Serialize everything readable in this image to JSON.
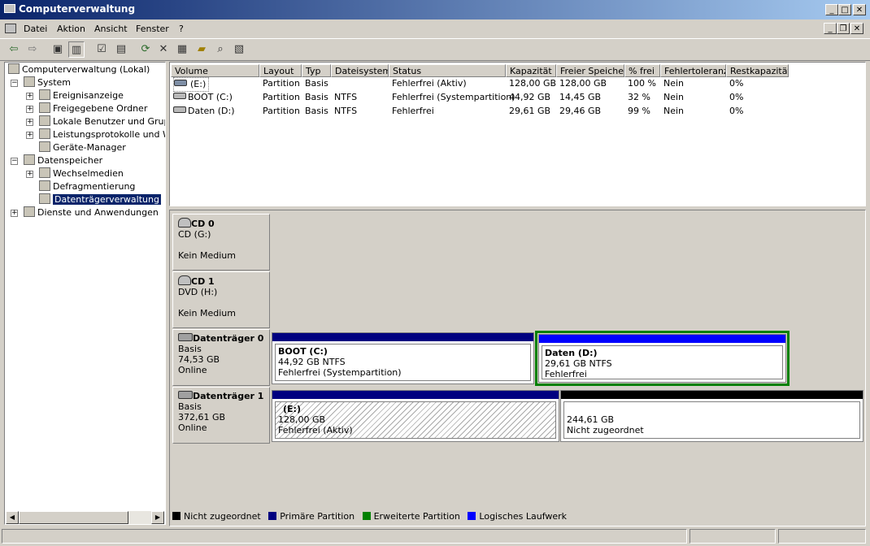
{
  "window": {
    "title": "Computerverwaltung"
  },
  "menu": [
    "Datei",
    "Aktion",
    "Ansicht",
    "Fenster",
    "?"
  ],
  "tree": {
    "root": "Computerverwaltung (Lokal)",
    "system": "System",
    "system_items": [
      "Ereignisanzeige",
      "Freigegebene Ordner",
      "Lokale Benutzer und Gruppe",
      "Leistungsprotokolle und War",
      "Geräte-Manager"
    ],
    "storage": "Datenspeicher",
    "storage_items": [
      "Wechselmedien",
      "Defragmentierung",
      "Datenträgerverwaltung"
    ],
    "services": "Dienste und Anwendungen"
  },
  "list": {
    "columns": [
      "Volume",
      "Layout",
      "Typ",
      "Dateisystem",
      "Status",
      "Kapazität",
      "Freier Speicher",
      "% frei",
      "Fehlertoleranz",
      "Restkapazität"
    ],
    "rows": [
      [
        "(E:)",
        "Partition",
        "Basis",
        "",
        "Fehlerfrei (Aktiv)",
        "128,00 GB",
        "128,00 GB",
        "100 %",
        "Nein",
        "0%"
      ],
      [
        "BOOT (C:)",
        "Partition",
        "Basis",
        "NTFS",
        "Fehlerfrei (Systempartition)",
        "44,92 GB",
        "14,45 GB",
        "32 %",
        "Nein",
        "0%"
      ],
      [
        "Daten (D:)",
        "Partition",
        "Basis",
        "NTFS",
        "Fehlerfrei",
        "29,61 GB",
        "29,46 GB",
        "99 %",
        "Nein",
        "0%"
      ]
    ]
  },
  "disks": {
    "cd0": {
      "name": "CD 0",
      "line1": "CD (G:)",
      "line2": "Kein Medium"
    },
    "cd1": {
      "name": "CD 1",
      "line1": "DVD (H:)",
      "line2": "Kein Medium"
    },
    "d0": {
      "name": "Datenträger 0",
      "type": "Basis",
      "size": "74,53 GB",
      "state": "Online"
    },
    "d1": {
      "name": "Datenträger 1",
      "type": "Basis",
      "size": "372,61 GB",
      "state": "Online"
    }
  },
  "volumes": {
    "boot": {
      "name": "BOOT  (C:)",
      "size": "44,92 GB NTFS",
      "status": "Fehlerfrei (Systempartition)"
    },
    "daten": {
      "name": "Daten  (D:)",
      "size": "29,61 GB NTFS",
      "status": "Fehlerfrei"
    },
    "e": {
      "name": "(E:)",
      "size": "128,00 GB",
      "status": "Fehlerfrei (Aktiv)"
    },
    "unalloc": {
      "size": "244,61 GB",
      "status": "Nicht zugeordnet"
    }
  },
  "legend": [
    "Nicht zugeordnet",
    "Primäre Partition",
    "Erweiterte Partition",
    "Logisches Laufwerk"
  ],
  "colors": {
    "primary": "#000080",
    "extended": "#008000",
    "logical": "#0000ff",
    "unallocated": "#000000",
    "titlebar": "#0a246a"
  }
}
